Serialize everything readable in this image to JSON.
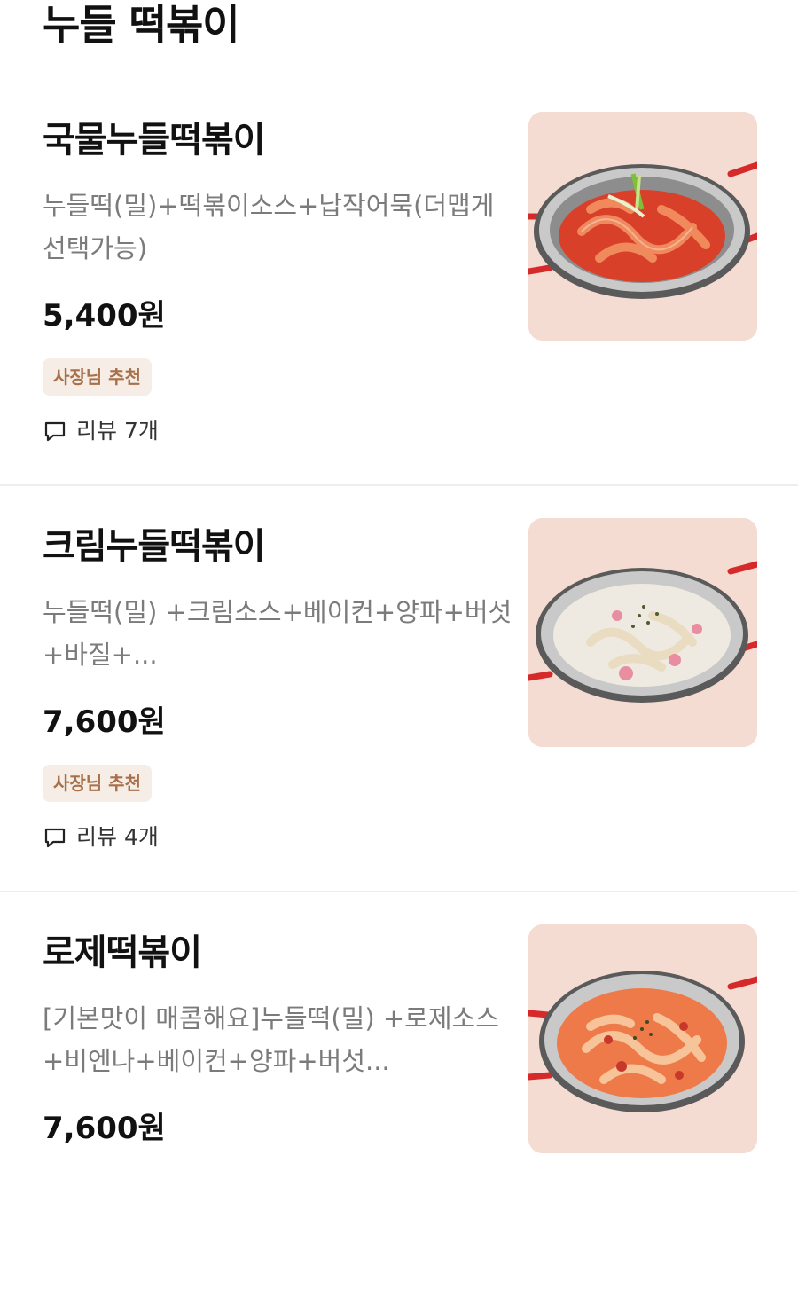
{
  "section": {
    "title": "누들 떡볶이"
  },
  "items": [
    {
      "name": "국물누들떡볶이",
      "description": "누들떡(밀)+떡볶이소스+납작어묵(더맵게 선택가능)",
      "price": "5,400원",
      "badge": "사장님 추천",
      "review": "리뷰 7개",
      "photo": "red-tteokbokki-pan-photo"
    },
    {
      "name": "크림누들떡볶이",
      "description": "누들떡(밀) +크림소스+베이컨+양파+버섯+바질+...",
      "price": "7,600원",
      "badge": "사장님 추천",
      "review": "리뷰 4개",
      "photo": "cream-tteokbokki-pan-photo"
    },
    {
      "name": "로제떡볶이",
      "description": "[기본맛이 매콤해요]누들떡(밀) +로제소스+비엔나+베이컨+양파+버섯...",
      "price": "7,600원",
      "photo": "rose-tteokbokki-pan-photo"
    }
  ],
  "colors": {
    "badge_text": "#a8704a",
    "badge_bg": "#f5ede6",
    "description": "#7b7b7b",
    "photo_bg": "#f2d9cf",
    "pan_handle": "#d62a2a",
    "red_sauce": "#e0452d",
    "cream_sauce": "#f3efe6",
    "rose_sauce": "#ee7a4a"
  }
}
